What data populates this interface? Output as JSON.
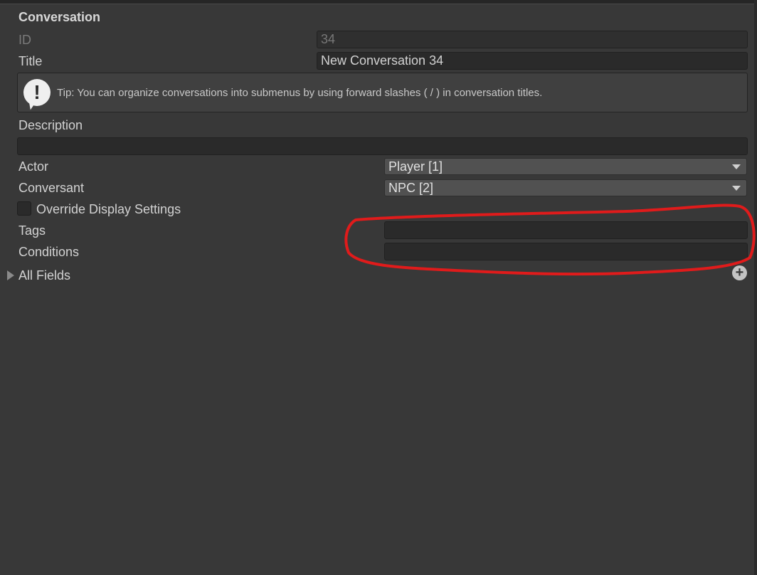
{
  "section": {
    "title": "Conversation"
  },
  "id_field": {
    "label": "ID",
    "value": "34"
  },
  "title_field": {
    "label": "Title",
    "value": "New Conversation 34"
  },
  "tip": {
    "icon": "exclamation-icon",
    "text": "Tip: You can organize conversations into submenus by using forward slashes ( / ) in conversation titles."
  },
  "description_field": {
    "label": "Description",
    "value": ""
  },
  "actor_field": {
    "label": "Actor",
    "value": "Player [1]"
  },
  "conversant_field": {
    "label": "Conversant",
    "value": "NPC [2]"
  },
  "override_display": {
    "label": "Override Display Settings",
    "checked": false
  },
  "tags_field": {
    "label": "Tags",
    "value": ""
  },
  "conditions_field": {
    "label": "Conditions",
    "value": ""
  },
  "all_fields": {
    "label": "All Fields",
    "expanded": false
  },
  "colors": {
    "background": "#383838",
    "field": "#2a2a2a",
    "annotation": "#e01b1b"
  }
}
